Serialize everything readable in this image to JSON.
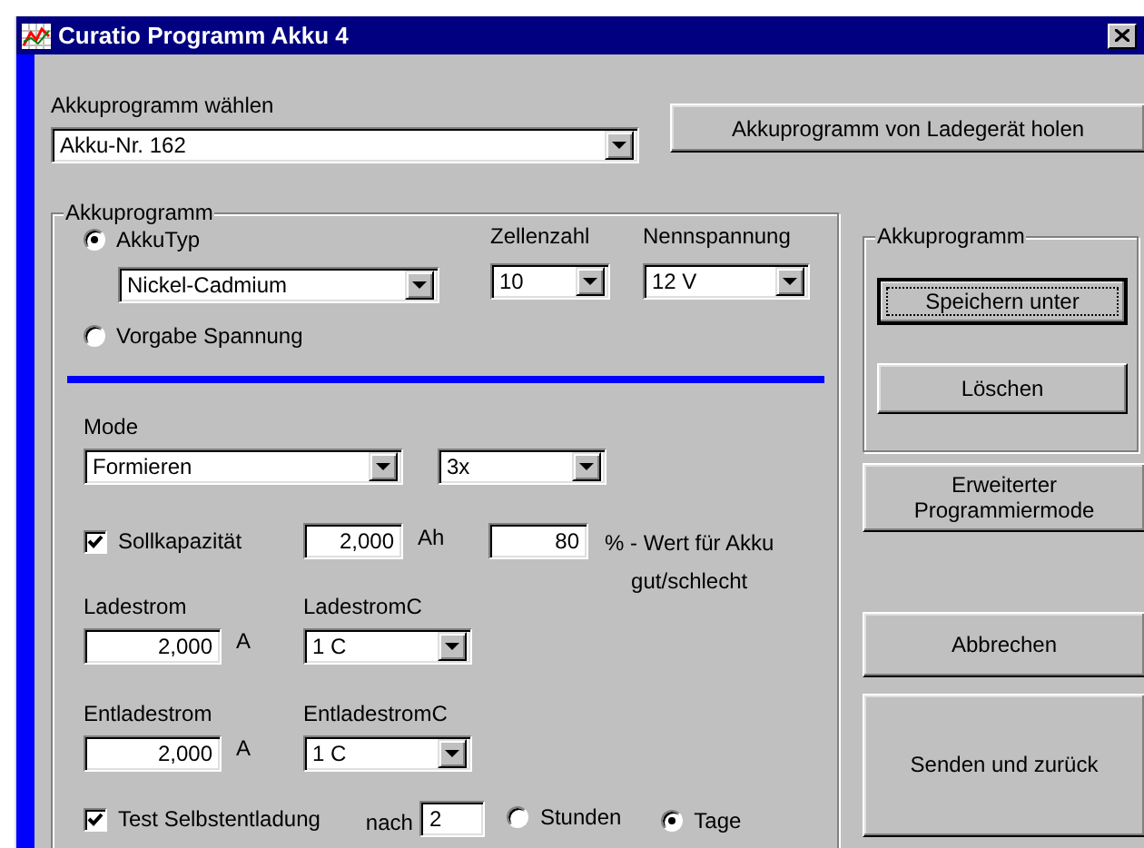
{
  "window": {
    "title": "Curatio Programm Akku 4"
  },
  "program_select": {
    "label": "Akkuprogramm wählen",
    "value": "Akku-Nr. 162"
  },
  "fetch_button": "Akkuprogramm von Ladegerät holen",
  "program_group": {
    "legend": "Akkuprogramm",
    "battery_type": {
      "label": "AkkuTyp",
      "selected": true,
      "value": "Nickel-Cadmium"
    },
    "cells": {
      "label": "Zellenzahl",
      "value": "10"
    },
    "voltage": {
      "label": "Nennspannung",
      "value": "12 V"
    },
    "preset_voltage": {
      "label": "Vorgabe Spannung",
      "selected": false
    },
    "mode": {
      "label": "Mode",
      "value": "Formieren",
      "repeat": "3x"
    },
    "capacity": {
      "label": "Sollkapazität",
      "checked": true,
      "value": "2,000",
      "unit": "Ah",
      "percent": "80",
      "percent_label": "% - Wert für Akku\ngut/schlecht"
    },
    "charge": {
      "label": "Ladestrom",
      "value": "2,000",
      "unit": "A",
      "c_label": "LadestromC",
      "c_value": "1 C"
    },
    "discharge": {
      "label": "Entladestrom",
      "value": "2,000",
      "unit": "A",
      "c_label": "EntladestromC",
      "c_value": "1 C"
    },
    "self_discharge": {
      "label": "Test Selbstentladung",
      "checked": true,
      "after_label": "nach",
      "value": "2",
      "units": [
        {
          "label": "Stunden",
          "selected": false
        },
        {
          "label": "Tage",
          "selected": true
        }
      ]
    }
  },
  "save_group": {
    "legend": "Akkuprogramm",
    "buttons": [
      {
        "label": "Speichern unter",
        "default": true
      },
      {
        "label": "Löschen",
        "default": false
      }
    ]
  },
  "buttons": [
    "Erweiterter Programmiermode",
    "Abbrechen",
    "Senden und zurück"
  ]
}
